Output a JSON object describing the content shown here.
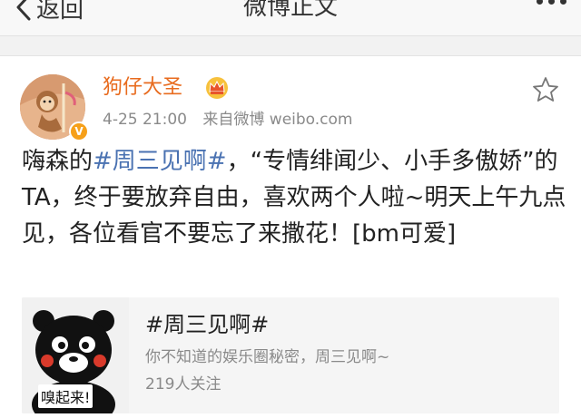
{
  "nav": {
    "back_label": "返回",
    "title": "微博正文"
  },
  "post": {
    "username": "狗仔大圣",
    "time": "4-25 21:00",
    "source": "来自微博 weibo.com",
    "content": {
      "part1": "嗨森的",
      "topic": "#周三见啊#",
      "part2": "，“专情绯闻少、小手多傲娇”的TA，终于要放弃自由，喜欢两个人啦~明天上午九点见，各位看官不要忘了来撒花！[bm可爱]"
    }
  },
  "card": {
    "title": "#周三见啊#",
    "description": "你不知道的娱乐圈秘密，周三见啊~",
    "followers": "219人关注",
    "image_caption": "嗅起来!"
  },
  "colors": {
    "username": "#e86b1e",
    "topic_link": "#4a72b2",
    "meta_text": "#8a8a8a",
    "vip_badge": "#f6a01a"
  },
  "icons": [
    "chevron-left-icon",
    "more-dots-icon",
    "crown-icon",
    "star-icon",
    "verified-badge-icon"
  ]
}
